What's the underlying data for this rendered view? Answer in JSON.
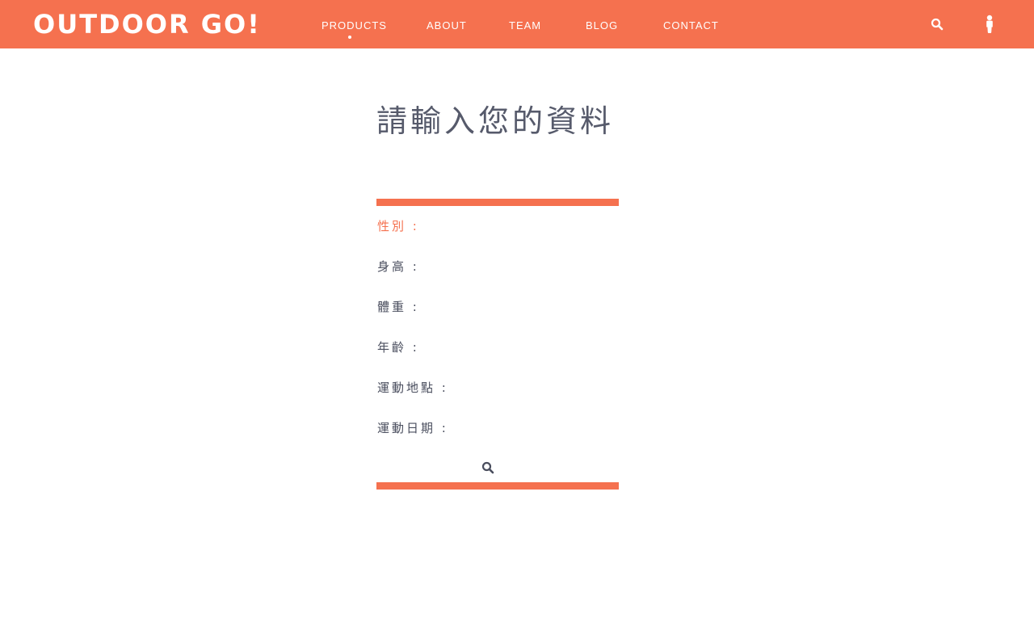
{
  "brand": {
    "logo_text": "OUTDOOR GO!"
  },
  "nav": {
    "items": [
      {
        "label": "PRODUCTS",
        "active": true
      },
      {
        "label": "ABOUT"
      },
      {
        "label": "TEAM"
      },
      {
        "label": "BLOG"
      },
      {
        "label": "CONTACT"
      }
    ],
    "icons": {
      "search": "search-icon",
      "user": "user-icon"
    }
  },
  "form": {
    "title": "請輸入您的資料",
    "fields": [
      {
        "label": "性別 :",
        "active": true
      },
      {
        "label": "身高 :"
      },
      {
        "label": "體重 :"
      },
      {
        "label": "年齡 :"
      },
      {
        "label": "運動地點 :"
      },
      {
        "label": "運動日期 :"
      }
    ],
    "submit_icon": "search-icon"
  },
  "colors": {
    "accent": "#f5714f",
    "text": "#4a4e5e",
    "title": "#565a6b",
    "background": "#ffffff"
  }
}
